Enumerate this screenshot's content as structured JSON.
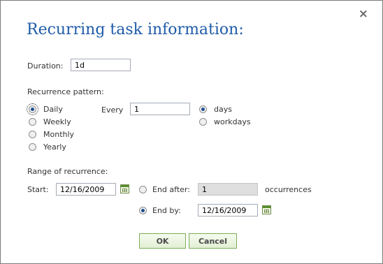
{
  "dialog": {
    "title": "Recurring task information:",
    "close_icon": "×"
  },
  "duration": {
    "label": "Duration:",
    "value": "1d"
  },
  "recurrence": {
    "label": "Recurrence pattern:",
    "options": [
      {
        "label": "Daily",
        "checked": true
      },
      {
        "label": "Weekly",
        "checked": false
      },
      {
        "label": "Monthly",
        "checked": false
      },
      {
        "label": "Yearly",
        "checked": false
      }
    ],
    "every_label": "Every",
    "every_value": "1",
    "unit_options": [
      {
        "label": "days",
        "checked": true
      },
      {
        "label": "workdays",
        "checked": false
      }
    ]
  },
  "range": {
    "label": "Range of recurrence:",
    "start_label": "Start:",
    "start_value": "12/16/2009",
    "end_after_label": "End after:",
    "end_after_value": "1",
    "occurrences_label": "occurrences",
    "end_by_label": "End by:",
    "end_by_value": "12/16/2009",
    "end_after_checked": false,
    "end_by_checked": true
  },
  "buttons": {
    "ok": "OK",
    "cancel": "Cancel"
  }
}
